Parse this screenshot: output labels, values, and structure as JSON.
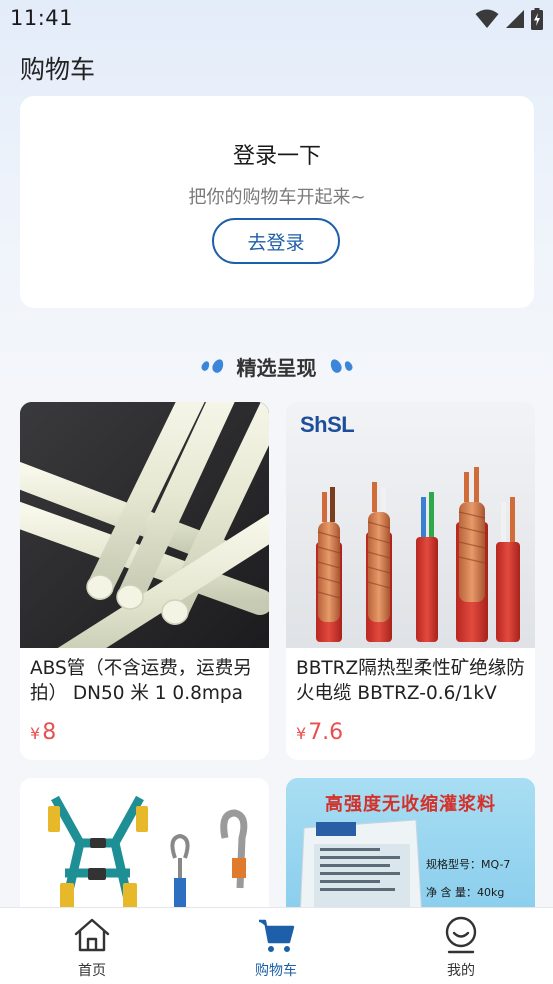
{
  "status": {
    "time": "11:41"
  },
  "page": {
    "title": "购物车"
  },
  "login": {
    "title": "登录一下",
    "subtitle": "把你的购物车开起来~",
    "button": "去登录"
  },
  "section": {
    "title": "精选呈现"
  },
  "products": [
    {
      "name": "ABS管（不含运费，运费另拍） DN50 米 1 0.8mpa",
      "currency": "¥",
      "price": "8",
      "image": "white-abs-rods"
    },
    {
      "name": "BBTRZ隔热型柔性矿绝缘防火电缆 BBTRZ-0.6/1kV",
      "currency": "¥",
      "price": "7.6",
      "image": "fire-resistant-cables",
      "brand": "ShSL"
    },
    {
      "name": "",
      "currency": "",
      "price": "",
      "image": "safety-harness"
    },
    {
      "name": "",
      "currency": "",
      "price": "",
      "image": "grout-bag",
      "banner": "高强度无收缩灌浆料",
      "spec_model": "规格型号：MQ-7",
      "spec_weight": "净 含 量：40kg"
    }
  ],
  "nav": {
    "items": [
      {
        "label": "首页",
        "icon": "home-icon",
        "active": false
      },
      {
        "label": "购物车",
        "icon": "cart-icon",
        "active": true
      },
      {
        "label": "我的",
        "icon": "profile-icon",
        "active": false
      }
    ]
  },
  "colors": {
    "accent": "#1d5fa8",
    "price": "#e8504e",
    "background": "#f4f6fa"
  }
}
